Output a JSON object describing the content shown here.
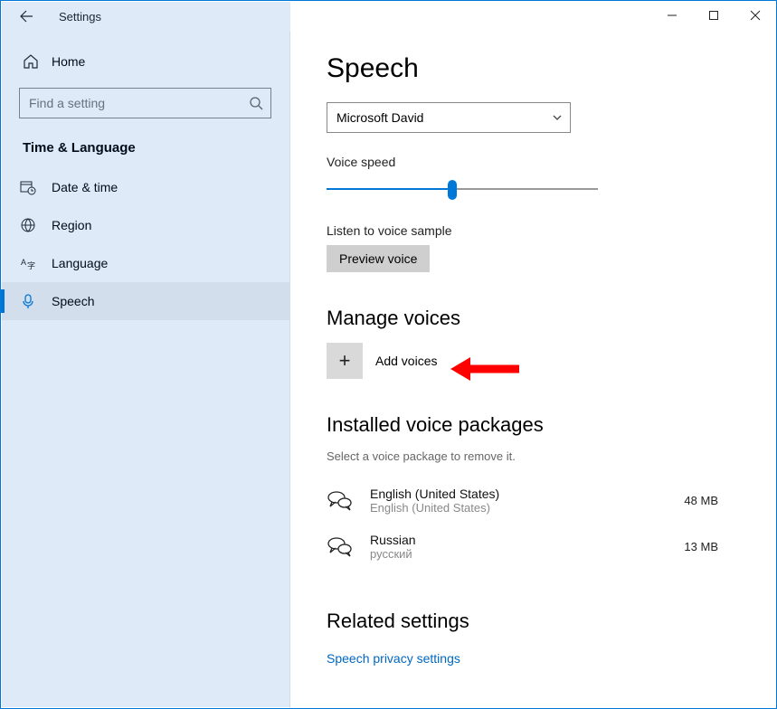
{
  "titlebar": {
    "title": "Settings"
  },
  "sidebar": {
    "home_label": "Home",
    "search_placeholder": "Find a setting",
    "category": "Time & Language",
    "items": [
      {
        "label": "Date & time"
      },
      {
        "label": "Region"
      },
      {
        "label": "Language"
      },
      {
        "label": "Speech"
      }
    ]
  },
  "main": {
    "heading": "Speech",
    "voice_select": "Microsoft David",
    "voice_speed_label": "Voice speed",
    "listen_label": "Listen to voice sample",
    "preview_button": "Preview voice",
    "manage_heading": "Manage voices",
    "add_voices_label": "Add voices",
    "installed_heading": "Installed voice packages",
    "installed_subtext": "Select a voice package to remove it.",
    "packages": [
      {
        "name": "English (United States)",
        "native": "English (United States)",
        "size": "48 MB"
      },
      {
        "name": "Russian",
        "native": "русский",
        "size": "13 MB"
      }
    ],
    "related_heading": "Related settings",
    "related_link": "Speech privacy settings"
  }
}
